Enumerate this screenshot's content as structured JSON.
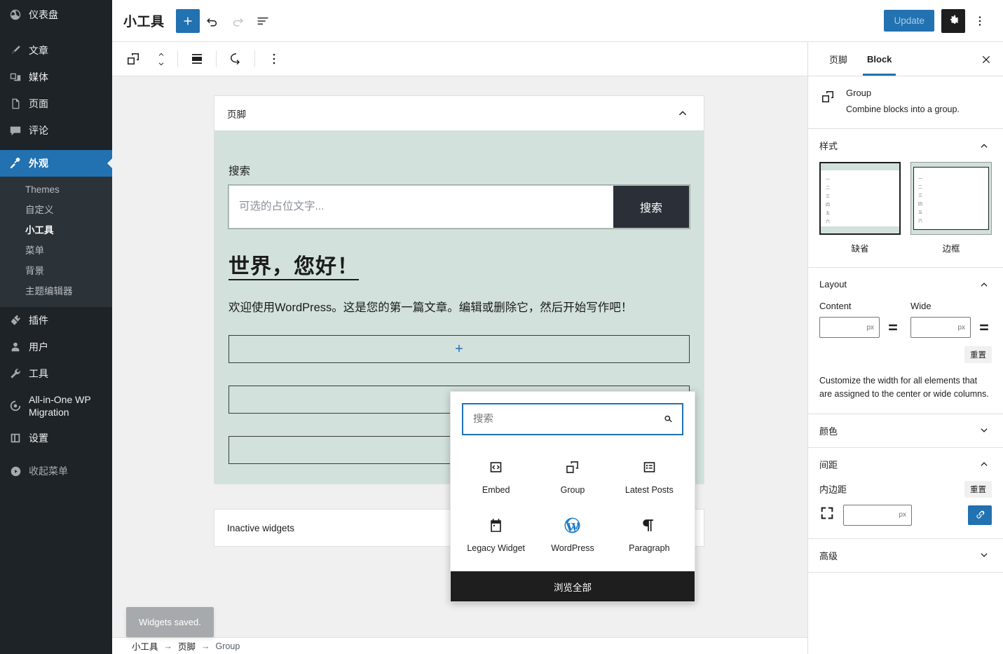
{
  "admin_menu": {
    "items": [
      {
        "label": "仪表盘",
        "icon": "dashboard-icon"
      },
      {
        "label": "文章",
        "icon": "posts-icon"
      },
      {
        "label": "媒体",
        "icon": "media-icon"
      },
      {
        "label": "页面",
        "icon": "pages-icon"
      },
      {
        "label": "评论",
        "icon": "comments-icon"
      },
      {
        "label": "外观",
        "icon": "appearance-icon",
        "current": true
      },
      {
        "label": "插件",
        "icon": "plugins-icon"
      },
      {
        "label": "用户",
        "icon": "users-icon"
      },
      {
        "label": "工具",
        "icon": "tools-icon"
      },
      {
        "label": "All-in-One WP Migration",
        "icon": "migration-icon"
      },
      {
        "label": "设置",
        "icon": "settings-icon"
      },
      {
        "label": "收起菜单",
        "icon": "collapse-icon"
      }
    ],
    "submenu": [
      {
        "label": "Themes"
      },
      {
        "label": "自定义"
      },
      {
        "label": "小工具",
        "active": true
      },
      {
        "label": "菜单"
      },
      {
        "label": "背景"
      },
      {
        "label": "主题编辑器"
      }
    ]
  },
  "header": {
    "title": "小工具",
    "add_block_label": "+",
    "update_label": "Update",
    "undo_icon": "undo-icon",
    "redo_icon": "redo-icon",
    "list_view_icon": "list-view-icon",
    "settings_icon": "gear-icon",
    "more_icon": "more-vertical-icon"
  },
  "block_toolbar": {
    "block_type_icon": "group-icon",
    "mover_icon": "move-up-down-icon",
    "align_icon": "align-icon",
    "transform_icon": "transform-icon",
    "options_icon": "more-vertical-icon"
  },
  "canvas": {
    "widget_area": {
      "title": "页脚",
      "collapse_icon": "chevron-up-icon",
      "search_block": {
        "label": "搜索",
        "placeholder": "可选的占位文字...",
        "button_label": "搜索"
      },
      "post_title": "世界，您好！",
      "post_body": "欢迎使用WordPress。这是您的第一篇文章。编辑或删除它，然后开始写作吧！",
      "appender_label": "+"
    },
    "inactive_widgets": {
      "title": "Inactive widgets",
      "toggle_icon": "chevron-down-icon"
    }
  },
  "snackbar": {
    "message": "Widgets saved."
  },
  "breadcrumb": {
    "items": [
      "小工具",
      "页脚",
      "Group"
    ],
    "separator": "→"
  },
  "sidebar": {
    "tabs": [
      {
        "label": "页脚",
        "active": false
      },
      {
        "label": "Block",
        "active": true
      }
    ],
    "close_icon": "close-icon",
    "block_card": {
      "icon": "group-icon",
      "title": "Group",
      "description": "Combine blocks into a group."
    },
    "panels": {
      "styles": {
        "title": "样式",
        "expanded": true,
        "options": [
          {
            "label": "缺省",
            "selected": true
          },
          {
            "label": "边框",
            "selected": false
          }
        ],
        "preview_lines": [
          "一",
          "二",
          "三",
          "四",
          "五",
          "六"
        ]
      },
      "layout": {
        "title": "Layout",
        "expanded": true,
        "content_label": "Content",
        "content_value": "",
        "content_unit": "px",
        "wide_label": "Wide",
        "wide_value": "",
        "wide_unit": "px",
        "reset_label": "重置",
        "help": "Customize the width for all elements that are assigned to the center or wide columns."
      },
      "color": {
        "title": "颜色",
        "expanded": false
      },
      "spacing": {
        "title": "间距",
        "expanded": true,
        "padding_label": "内边距",
        "reset_label": "重置",
        "padding_value": "",
        "padding_unit": "px",
        "link_icon": "link-icon"
      },
      "advanced": {
        "title": "高级",
        "expanded": false
      }
    }
  },
  "inserter": {
    "search_placeholder": "搜索",
    "search_value": "",
    "search_icon": "search-icon",
    "blocks": [
      {
        "label": "Embed",
        "icon": "embed-icon"
      },
      {
        "label": "Group",
        "icon": "group-icon"
      },
      {
        "label": "Latest Posts",
        "icon": "latest-posts-icon"
      },
      {
        "label": "Legacy Widget",
        "icon": "legacy-widget-icon"
      },
      {
        "label": "WordPress",
        "icon": "wordpress-icon"
      },
      {
        "label": "Paragraph",
        "icon": "paragraph-icon"
      }
    ],
    "browse_all_label": "浏览全部"
  },
  "colors": {
    "accent": "#2271b1",
    "admin_bg": "#1d2327",
    "canvas_block_bg": "#d2e1db",
    "dark_button": "#2b3038"
  }
}
